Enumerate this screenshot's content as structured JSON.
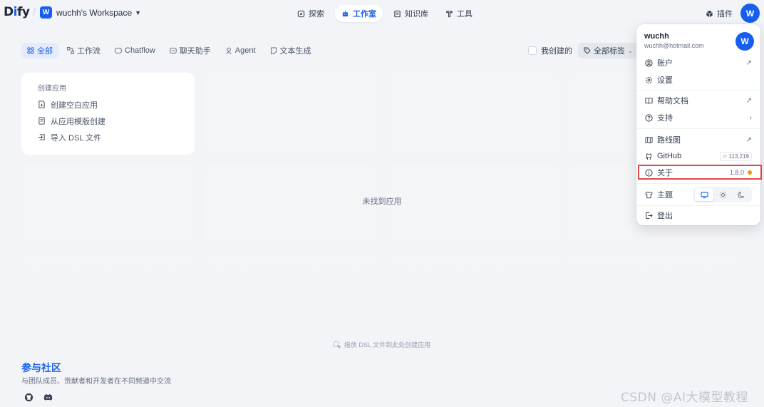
{
  "brand": {
    "logo_prefix": "D",
    "logo_i": "i",
    "logo_suffix": "fy",
    "accent": "#155eef"
  },
  "workspace": {
    "badge": "W",
    "name": "wuchh's Workspace"
  },
  "nav": {
    "tabs": [
      {
        "label": "探索",
        "icon": "compass-icon"
      },
      {
        "label": "工作室",
        "icon": "robot-icon",
        "active": true
      },
      {
        "label": "知识库",
        "icon": "book-icon"
      },
      {
        "label": "工具",
        "icon": "hammer-icon"
      }
    ],
    "plugin_label": "插件",
    "avatar_initial": "W"
  },
  "filters": {
    "items": [
      {
        "label": "全部",
        "active": true
      },
      {
        "label": "工作流"
      },
      {
        "label": "Chatflow"
      },
      {
        "label": "聊天助手"
      },
      {
        "label": "Agent"
      },
      {
        "label": "文本生成"
      }
    ],
    "mine_label": "我创建的",
    "tag_label": "全部标签"
  },
  "create_card": {
    "title": "创建应用",
    "items": [
      "创建空白应用",
      "从应用模版创建",
      "导入 DSL 文件"
    ]
  },
  "empty_message": "未找到应用",
  "drop_hint": "拖放 DSL 文件到此处创建应用",
  "community": {
    "title": "参与社区",
    "description": "与团队成员、贡献者和开发者在不同频道中交流"
  },
  "watermark": "CSDN @AI大模型教程",
  "menu": {
    "user_name": "wuchh",
    "user_email": "wuchh@hotmail.com",
    "avatar_initial": "W",
    "items": {
      "account": "账户",
      "settings": "设置",
      "help_docs": "帮助文档",
      "support": "支持",
      "roadmap": "路线图",
      "github": "GitHub",
      "github_stars": "113,219",
      "about": "关于",
      "about_version": "1.8.0",
      "theme": "主题",
      "logout": "登出"
    },
    "status_dot_color": "#f79009"
  }
}
